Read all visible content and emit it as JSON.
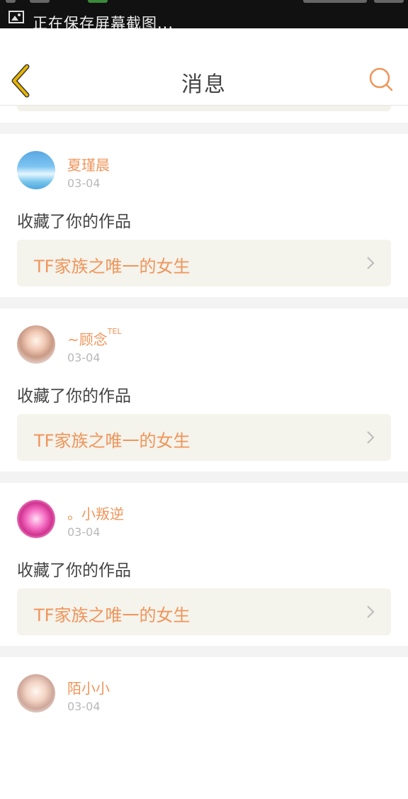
{
  "status_bar": {
    "notification": "正在保存屏幕截图..."
  },
  "header": {
    "title": "消息"
  },
  "colors": {
    "accent": "#f0955a",
    "back_arrow": "#e8b400",
    "link_bg": "#f4f3ec"
  },
  "icons": {
    "back": "chevron-left-icon",
    "search": "search-icon",
    "open": "chevron-right-icon"
  },
  "messages": [
    {
      "user": "夏瑾晨",
      "user_sup": "",
      "date": "03-04",
      "action": "收藏了你的作品",
      "work": "TF家族之唯一的女生"
    },
    {
      "user": "~顾念",
      "user_sup": "TEL",
      "date": "03-04",
      "action": "收藏了你的作品",
      "work": "TF家族之唯一的女生"
    },
    {
      "user": "。小叛逆",
      "user_sup": "",
      "date": "03-04",
      "action": "收藏了你的作品",
      "work": "TF家族之唯一的女生"
    },
    {
      "user": "陌小小",
      "user_sup": "",
      "date": "03-04"
    }
  ]
}
